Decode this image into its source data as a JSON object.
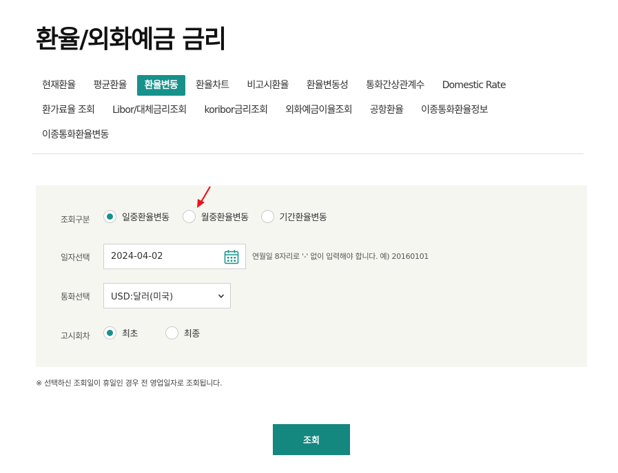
{
  "page": {
    "title": "환율/외화예금 금리"
  },
  "tabs": [
    {
      "label": "현재환율",
      "active": false
    },
    {
      "label": "평균환율",
      "active": false
    },
    {
      "label": "환율변동",
      "active": true
    },
    {
      "label": "환율차트",
      "active": false
    },
    {
      "label": "비고시환율",
      "active": false
    },
    {
      "label": "환율변동성",
      "active": false
    },
    {
      "label": "통화간상관계수",
      "active": false
    },
    {
      "label": "Domestic Rate",
      "active": false
    },
    {
      "label": "환가료율 조회",
      "active": false
    },
    {
      "label": "Libor/대체금리조회",
      "active": false
    },
    {
      "label": "koribor금리조회",
      "active": false
    },
    {
      "label": "외화예금이율조회",
      "active": false
    },
    {
      "label": "공항환율",
      "active": false
    },
    {
      "label": "이종통화환율정보",
      "active": false
    },
    {
      "label": "이종통화환율변동",
      "active": false
    }
  ],
  "form": {
    "query_type": {
      "label": "조회구분",
      "options": [
        "일중환율변동",
        "월중환율변동",
        "기간환율변동"
      ],
      "selected": "일중환율변동"
    },
    "date": {
      "label": "일자선택",
      "value": "2024-04-02",
      "hint": "연월일 8자리로 '-' 없이 입력해야 합니다. 예) 20160101"
    },
    "currency": {
      "label": "통화선택",
      "selected": "USD:달러(미국)"
    },
    "notice_round": {
      "label": "고시회차",
      "options": [
        "최초",
        "최종"
      ],
      "selected": "최초"
    }
  },
  "notice": "※ 선택하신 조회일이 휴일인 경우 전 영업일자로 조회됩니다.",
  "buttons": {
    "search": "조회"
  },
  "colors": {
    "accent": "#16918b",
    "panel_bg": "#f6f6f1",
    "annotation": "#e8141c"
  }
}
